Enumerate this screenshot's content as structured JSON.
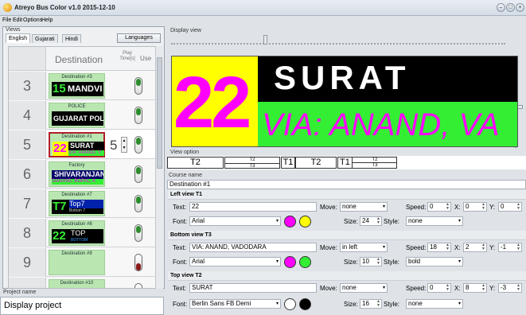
{
  "window": {
    "title": "Atreyo Bus Color v1.0 2015-12-10"
  },
  "menu": [
    "File",
    "Edit",
    "Options",
    "Help"
  ],
  "left": {
    "views_label": "Views",
    "tabs": [
      "English",
      "Gujarati",
      "Hindi"
    ],
    "languages_button": "Languages",
    "table_headers": {
      "destination": "Destination",
      "play": "Play Time[s]",
      "use": "Use"
    },
    "rows": [
      {
        "num": "3",
        "caption": "Destination #3",
        "screen_main": "15",
        "screen_text": "MANDVI",
        "play": "",
        "use": "on"
      },
      {
        "num": "4",
        "caption": "POLICE",
        "screen_main": "",
        "screen_text": "GUJARAT POLICE",
        "play": "",
        "use": "on"
      },
      {
        "num": "5",
        "caption": "Destination #1",
        "screen_main": "22",
        "screen_text": "SURAT",
        "screen_sub": "VIA: ANAND, V",
        "play": "5",
        "use": "on"
      },
      {
        "num": "6",
        "caption": "Factory",
        "screen_main": "",
        "screen_text": "SHIVARANJANI",
        "screen_sub": "SANAND, BOPAL, K",
        "play": "",
        "use": "on"
      },
      {
        "num": "7",
        "caption": "Destination #7",
        "screen_main": "T7",
        "screen_text": "Top7",
        "screen_sub": "Bottom 7",
        "play": "",
        "use": "on"
      },
      {
        "num": "8",
        "caption": "Destination #8",
        "screen_main": "22",
        "screen_text": "TOP",
        "screen_sub": "BOTTOM",
        "play": "",
        "use": "on"
      },
      {
        "num": "9",
        "caption": "Destination #9",
        "screen_main": "",
        "screen_text": "",
        "play": "",
        "use": "off"
      },
      {
        "num": "",
        "caption": "Destination #10",
        "screen_main": "",
        "screen_text": "",
        "play": "",
        "use": "off"
      }
    ],
    "project_label": "Project name",
    "project_value": "Display project"
  },
  "right": {
    "display_label": "Display view",
    "display": {
      "number": "22",
      "top": "SURAT",
      "bottom": "VIA: ANAND, VA"
    },
    "view_option_label": "View option",
    "view_options": [
      {
        "a": "T2",
        "b": "",
        "c": ""
      },
      {
        "a": "",
        "b": "T2",
        "c": "T3"
      },
      {
        "a": "T1",
        "b": "",
        "c": ""
      },
      {
        "a": "T2",
        "b": "",
        "c": ""
      },
      {
        "a": "T1",
        "b": "T2",
        "c": "T3"
      }
    ],
    "course_label": "Course name",
    "course_value": "Destination #1",
    "sections": [
      {
        "title": "Left view T1",
        "text": "22",
        "move": "none",
        "speed": "0",
        "x": "0",
        "y": "0",
        "font": "Arial",
        "size": "24",
        "style": "none",
        "c1": "#ff00ff",
        "c2": "#ffff00"
      },
      {
        "title": "Bottom view T3",
        "text": "VIA: ANAND, VADODARA",
        "move": "in left",
        "speed": "18",
        "x": "2",
        "y": "-1",
        "font": "Arial",
        "size": "10",
        "style": "bold",
        "c1": "#ff00ff",
        "c2": "#33ee33"
      },
      {
        "title": "Top view T2",
        "text": "SURAT",
        "move": "none",
        "speed": "0",
        "x": "8",
        "y": "-3",
        "font": "Berlin Sans FB Demi",
        "size": "16",
        "style": "none",
        "c1": "#ffffff",
        "c2": "#000000"
      }
    ],
    "labels": {
      "text": "Text:",
      "move": "Move:",
      "speed": "Speed:",
      "x": "X:",
      "y": "Y:",
      "font": "Font:",
      "size": "Size:",
      "style": "Style:"
    }
  },
  "colors": {
    "accent": "#ff00ff",
    "yellow": "#ffff00",
    "green": "#33ee33",
    "thumb": "#b9e6b1",
    "toggle_on": "#2e8b2e",
    "toggle_off": "#8b1a1a"
  }
}
